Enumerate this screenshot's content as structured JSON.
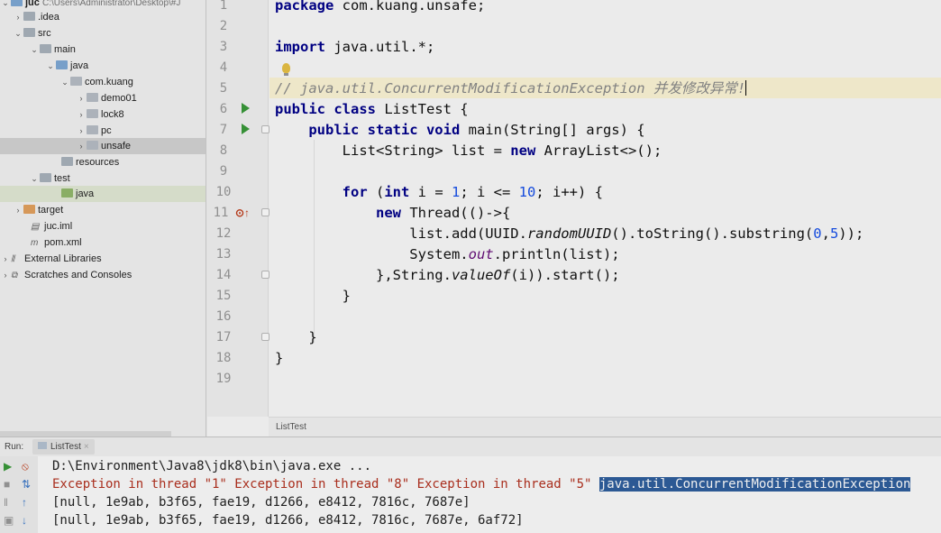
{
  "tree": {
    "project": {
      "name": "juc",
      "path": "C:\\Users\\Administrator\\Desktop\\#J"
    },
    "items": [
      {
        "label": ".idea"
      },
      {
        "label": "src"
      },
      {
        "label": "main"
      },
      {
        "label": "java"
      },
      {
        "label": "com.kuang"
      },
      {
        "label": "demo01"
      },
      {
        "label": "lock8"
      },
      {
        "label": "pc"
      },
      {
        "label": "unsafe"
      },
      {
        "label": "resources"
      },
      {
        "label": "test"
      },
      {
        "label": "java"
      },
      {
        "label": "target"
      },
      {
        "label": "juc.iml"
      },
      {
        "label": "pom.xml"
      },
      {
        "label": "External Libraries"
      },
      {
        "label": "Scratches and Consoles"
      }
    ]
  },
  "editor": {
    "line_numbers": [
      "1",
      "2",
      "3",
      "4",
      "5",
      "6",
      "7",
      "8",
      "9",
      "10",
      "11",
      "12",
      "13",
      "14",
      "15",
      "16",
      "17",
      "18",
      "19"
    ],
    "code": {
      "l1_kw": "package",
      "l1_rest": " com.kuang.unsafe;",
      "l3_kw": "import",
      "l3_rest": " java.util.*;",
      "l5_comment": "// java.util.ConcurrentModificationException 并发修改异常!",
      "l6_kw": "public class",
      "l6_rest": " ListTest {",
      "l7_indent": "    ",
      "l7_kw": "public static void",
      "l7_rest": " main(String[] args) {",
      "l8_a": "        List<String> list = ",
      "l8_kw": "new",
      "l8_b": " ArrayList<>();",
      "l10_indent": "        ",
      "l10_kw1": "for",
      "l10_a": " (",
      "l10_kw2": "int",
      "l10_b": " i = ",
      "l10_n1": "1",
      "l10_c": "; i <= ",
      "l10_n2": "10",
      "l10_d": "; i++) {",
      "l11_indent": "            ",
      "l11_kw": "new",
      "l11_rest": " Thread(()->{",
      "l12_a": "                list.add(UUID.",
      "l12_it": "randomUUID",
      "l12_b": "().toString().substring(",
      "l12_n1": "0",
      "l12_c": ",",
      "l12_n2": "5",
      "l12_d": "));",
      "l13_a": "                System.",
      "l13_fld": "out",
      "l13_b": ".println(list);",
      "l14_a": "            },String.",
      "l14_it": "valueOf",
      "l14_b": "(i)).start();",
      "l15": "        }",
      "l17": "    }",
      "l18": "}"
    },
    "override_icon": "override-marker-icon",
    "breadcrumb": "ListTest"
  },
  "run_panel": {
    "label": "Run:",
    "tab": "ListTest",
    "tab_close": "×",
    "lines": {
      "cmd": "D:\\Environment\\Java8\\jdk8\\bin\\java.exe ...",
      "err_text": "Exception in thread \"1\" Exception in thread \"8\" Exception in thread \"5\" ",
      "err_selected": "java.util.ConcurrentModificationException",
      "out1": "[null, 1e9ab, b3f65, fae19, d1266, e8412, 7816c, 7687e]",
      "out2": "[null, 1e9ab, b3f65, fae19, d1266, e8412, 7816c, 7687e, 6af72]"
    }
  }
}
